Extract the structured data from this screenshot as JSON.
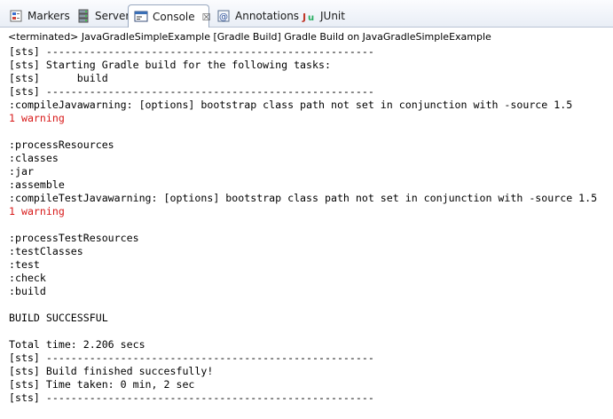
{
  "tabs": [
    {
      "label": "Markers",
      "icon": "markers-icon",
      "active": false
    },
    {
      "label": "Servers",
      "icon": "servers-icon",
      "active": false
    },
    {
      "label": "Console",
      "icon": "console-icon",
      "active": true
    },
    {
      "label": "Annotations",
      "icon": "annotations-icon",
      "active": false
    },
    {
      "label": "JUnit",
      "icon": "junit-icon",
      "active": false
    }
  ],
  "close_symbol": "☒",
  "console": {
    "title": "<terminated> JavaGradleSimpleExample [Gradle Build] Gradle Build on JavaGradleSimpleExample",
    "lines": [
      {
        "text": "[sts] -----------------------------------------------------",
        "color": "#000000"
      },
      {
        "text": "[sts] Starting Gradle build for the following tasks:",
        "color": "#000000"
      },
      {
        "text": "[sts]      build",
        "color": "#000000"
      },
      {
        "text": "[sts] -----------------------------------------------------",
        "color": "#000000"
      },
      {
        "text": ":compileJavawarning: [options] bootstrap class path not set in conjunction with -source 1.5",
        "color": "#000000"
      },
      {
        "text": "1 warning",
        "color": "#d81a1a"
      },
      {
        "text": "",
        "color": "#000000"
      },
      {
        "text": ":processResources",
        "color": "#000000"
      },
      {
        "text": ":classes",
        "color": "#000000"
      },
      {
        "text": ":jar",
        "color": "#000000"
      },
      {
        "text": ":assemble",
        "color": "#000000"
      },
      {
        "text": ":compileTestJavawarning: [options] bootstrap class path not set in conjunction with -source 1.5",
        "color": "#000000"
      },
      {
        "text": "1 warning",
        "color": "#d81a1a"
      },
      {
        "text": "",
        "color": "#000000"
      },
      {
        "text": ":processTestResources",
        "color": "#000000"
      },
      {
        "text": ":testClasses",
        "color": "#000000"
      },
      {
        "text": ":test",
        "color": "#000000"
      },
      {
        "text": ":check",
        "color": "#000000"
      },
      {
        "text": ":build",
        "color": "#000000"
      },
      {
        "text": "",
        "color": "#000000"
      },
      {
        "text": "BUILD SUCCESSFUL",
        "color": "#000000"
      },
      {
        "text": "",
        "color": "#000000"
      },
      {
        "text": "Total time: 2.206 secs",
        "color": "#000000"
      },
      {
        "text": "[sts] -----------------------------------------------------",
        "color": "#000000"
      },
      {
        "text": "[sts] Build finished succesfully!",
        "color": "#000000"
      },
      {
        "text": "[sts] Time taken: 0 min, 2 sec",
        "color": "#000000"
      },
      {
        "text": "[sts] -----------------------------------------------------",
        "color": "#000000"
      }
    ]
  }
}
